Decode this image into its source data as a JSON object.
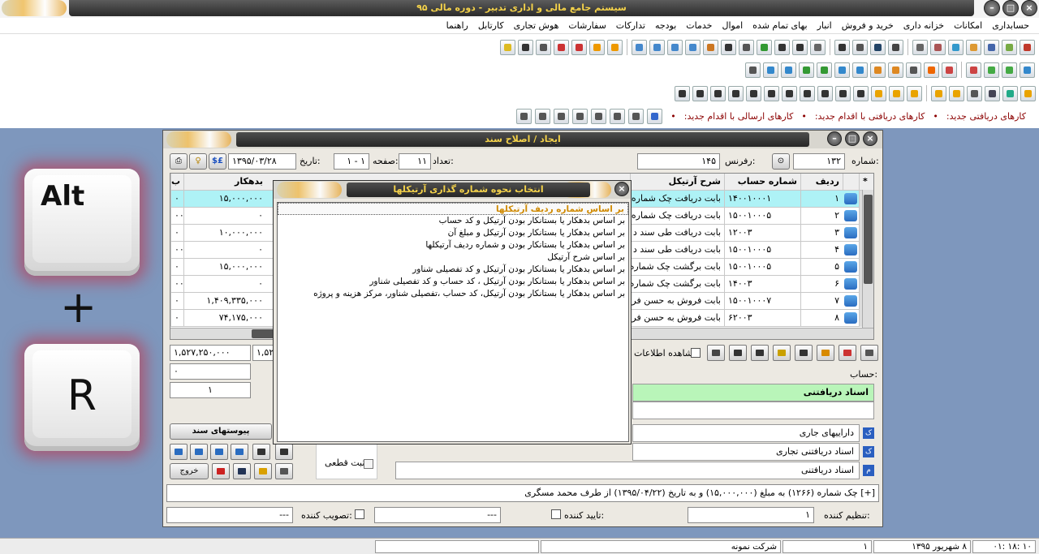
{
  "app": {
    "title": "سیستم جامع مالی و اداری تدبیر - دوره مالی ۹۵"
  },
  "menu": [
    "حسابداری",
    "امکانات",
    "خزانه داری",
    "خرید و فروش",
    "انبار",
    "بهای تمام شده",
    "اموال",
    "خدمات",
    "بودجه",
    "تدارکات",
    "سفارشات",
    "هوش تجاری",
    "کارتابل",
    "راهنما"
  ],
  "notifications": {
    "received": "کارهای دریافتی جدید:",
    "received_dot": "•",
    "received_action": "کارهای دریافتی با اقدام جدید:",
    "received_action_dot": "•",
    "sent_action": "کارهای ارسالی با اقدام جدید:",
    "sent_action_dot": "•"
  },
  "doc_window": {
    "title": "ایجاد / اصلاح سند",
    "number_label": "شماره:",
    "number_value": "۱۳۲",
    "reference_label": "رفرنس:",
    "reference_value": "۱۴۵",
    "count_label": "تعداد:",
    "count_value": "۱۱",
    "page_label": "صفحه:",
    "page_value": "۱ - ۱",
    "date_label": "تاریخ:",
    "date_value": "۱۳۹۵/۰۳/۲۸",
    "currency_button": "$£",
    "columns": {
      "selector": "*",
      "row": "ردیف",
      "account": "شماره حساب",
      "description": "شرح آرتیکل",
      "debit": "بدهکار",
      "credit": "ب"
    },
    "rows": [
      {
        "row": "۱",
        "account": "۱۴۰۰۱۰۰۰۱",
        "description": "بابت دریافت چک شماره",
        "debit": "۱۵,۰۰۰,۰۰۰",
        "credit": "۰"
      },
      {
        "row": "۲",
        "account": "۱۵۰۰۱۰۰۰۵",
        "description": "بابت دریافت چک شماره",
        "debit": "۰",
        "credit": "۰۰"
      },
      {
        "row": "۳",
        "account": "۱۲۰۰۳",
        "description": "بابت دریافت طی سند د",
        "debit": "۱۰,۰۰۰,۰۰۰",
        "credit": "۰"
      },
      {
        "row": "۴",
        "account": "۱۵۰۰۱۰۰۰۵",
        "description": "بابت دریافت طی سند د",
        "debit": "۰",
        "credit": "۰۰"
      },
      {
        "row": "۵",
        "account": "۱۵۰۰۱۰۰۰۵",
        "description": "بابت برگشت چک شماره",
        "debit": "۱۵,۰۰۰,۰۰۰",
        "credit": "۰"
      },
      {
        "row": "۶",
        "account": "۱۴۰۰۳",
        "description": "بابت برگشت چک شماره",
        "debit": "۰",
        "credit": "۰۰"
      },
      {
        "row": "۷",
        "account": "۱۵۰۰۱۰۰۰۷",
        "description": "بابت فروش به حسن فرا",
        "debit": "۱,۴۰۹,۳۳۵,۰۰۰",
        "credit": "۰"
      },
      {
        "row": "۸",
        "account": "۶۲۰۰۳",
        "description": "بابت فروش به حسن فرا",
        "debit": "۷۴,۱۷۵,۰۰۰",
        "credit": "۰"
      }
    ],
    "total_debit": "۱,۵۲۷,۲۵۰,۰۰۰",
    "total_credit": "۱,۵۲",
    "diff_value": "۰",
    "counter_value": "۱",
    "show_info_label": "مشاهده اطلاعات",
    "account_label": "حساب:",
    "account_group_header": "اسناد دریافتنی",
    "account_levels": [
      {
        "icon": "ک",
        "name": "داراییهای جاری"
      },
      {
        "icon": "ک",
        "name": "اسناد دریافتنی تجاری"
      },
      {
        "icon": "م",
        "name": "اسناد دریافتنی"
      }
    ],
    "attachments_button": "پیوستهای سند",
    "final_label": "ثبت قطعی",
    "exit_button": "خروج",
    "note_text": "[+] چک شماره (۱۲۶۶) به مبلغ (۱۵,۰۰۰,۰۰۰) و به تاریخ (۱۳۹۵/۰۴/۲۲) از طرف محمد مسگری",
    "prepared_by_label": "تنظیم کننده:",
    "prepared_by_value": "۱",
    "confirmed_by_label": "تایید کننده:",
    "confirmed_by_value": "---",
    "approved_by_label": "تصویب کننده:",
    "approved_by_value": "---"
  },
  "dialog": {
    "title": "انتخاب نحوه شماره گذاری آرتیکلها",
    "options": [
      "بر اساس شماره ردیف آرتیکلها",
      "بر اساس بدهکار یا بستانکار بودن آرتیکل و کد حساب",
      "بر اساس بدهکار یا بستانکار بودن آرتیکل و مبلغ آن",
      "بر اساس بدهکار یا بستانکار بودن و شماره ردیف آرتیکلها",
      "بر اساس شرح آرتیکل",
      "بر اساس بدهکار یا بستانکار بودن آرتیکل و کد تفصیلی شناور",
      "بر اساس بدهکار یا بستانکار بودن آرتیکل ، کد حساب و کد تفصیلی شناور",
      "بر اساس بدهکار یا بستانکار بودن آرتیکل، کد حساب ،تفصیلی شناور، مرکز هزینه و پروژه"
    ],
    "selected_index": 0
  },
  "keys": {
    "modifier": "Alt",
    "plus": "+",
    "letter": "R"
  },
  "statusbar": {
    "time": "۱۰ :۱۸ :۰۱",
    "date": "۸ شهریور ۱۳۹۵",
    "user_id": "۱",
    "company": "شرکت نمونه"
  },
  "colors": {
    "title_text": "#f4d24a",
    "selected_row": "#aef2f6",
    "desktop": "#7e97bd",
    "group_header": "#b9f5b9"
  }
}
